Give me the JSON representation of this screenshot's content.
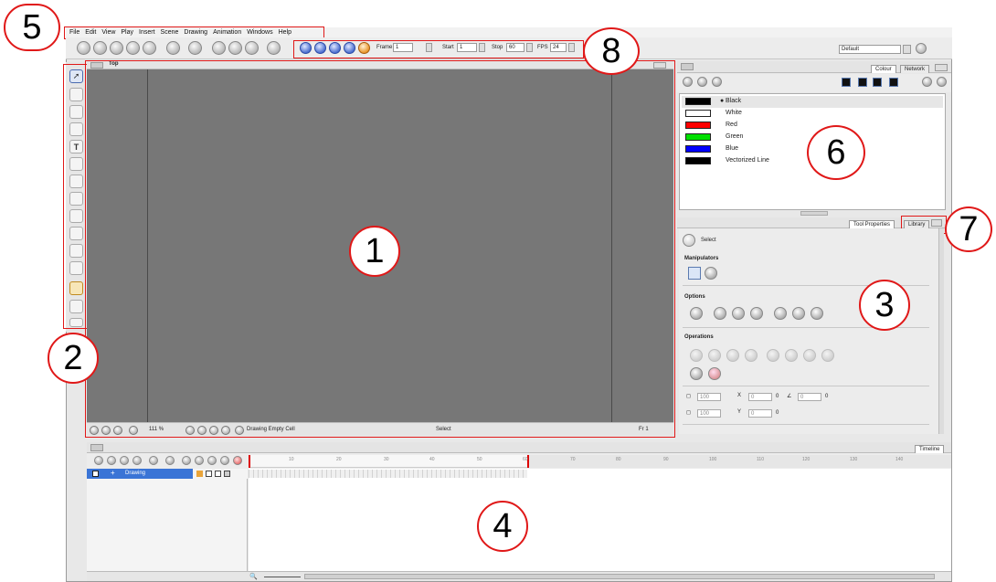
{
  "menu": {
    "items": [
      "File",
      "Edit",
      "View",
      "Play",
      "Insert",
      "Scene",
      "Drawing",
      "Animation",
      "Windows",
      "Help"
    ]
  },
  "toolbar": {
    "frame_label": "Frame",
    "frame_value": "1",
    "start_label": "Start",
    "start_value": "1",
    "stop_label": "Stop",
    "stop_value": "60",
    "fps_label": "FPS",
    "fps_value": "24",
    "workspace_value": "Default"
  },
  "camera_view": {
    "view_name": "Top",
    "zoom": "111 %",
    "cell_status": "Drawing Empty Cell",
    "tool_status": "Select",
    "frame_status": "Fr 1"
  },
  "colour_panel": {
    "tabs": [
      "Colour",
      "Network"
    ],
    "swatches": [
      {
        "name": "Black",
        "color": "#000000",
        "selected": true
      },
      {
        "name": "White",
        "color": "#ffffff",
        "selected": false
      },
      {
        "name": "Red",
        "color": "#ff0000",
        "selected": false
      },
      {
        "name": "Green",
        "color": "#00e000",
        "selected": false
      },
      {
        "name": "Blue",
        "color": "#0000ff",
        "selected": false
      },
      {
        "name": "Vectorized Line",
        "color": "#000000",
        "selected": false
      }
    ]
  },
  "tool_properties": {
    "tabs": [
      "Tool Properties",
      "Library"
    ],
    "tool_name": "Select",
    "sections": {
      "manipulators": "Manipulators",
      "options": "Options",
      "operations": "Operations"
    },
    "width_value": "100",
    "height_value": "100",
    "x_value": "0",
    "y_value": "0",
    "angle_value": "0",
    "deg_x": "0",
    "deg_y": "0",
    "deg_angle": "0"
  },
  "timeline": {
    "tab": "Timeline",
    "layer_name": "Drawing",
    "ruler_marks": [
      "10",
      "20",
      "30",
      "40",
      "50",
      "60",
      "70",
      "80",
      "90",
      "100",
      "110",
      "120",
      "130",
      "140"
    ]
  },
  "callouts": [
    "1",
    "2",
    "3",
    "4",
    "5",
    "6",
    "7",
    "8"
  ],
  "colors": {
    "accent_red": "#e01818",
    "view_gray": "#777777",
    "layer_blue": "#3a74d6"
  }
}
